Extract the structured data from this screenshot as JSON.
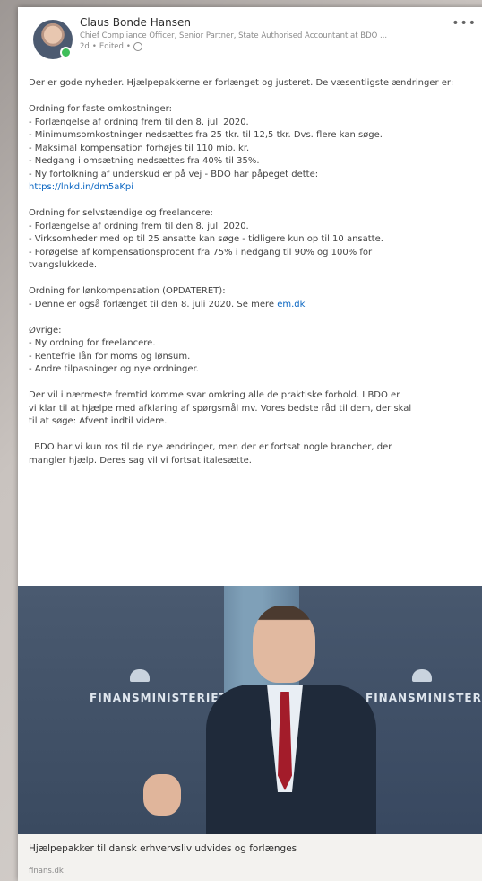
{
  "post": {
    "author_name": "Claus Bonde Hansen",
    "author_title": "Chief Compliance Officer, Senior Partner, State Authorised Accountant at BDO ...",
    "time": "2d",
    "edited": "Edited",
    "more_icon": "more-options-icon",
    "intro": "Der er gode nyheder. Hjælpepakkerne er forlænget og justeret. De væsentligste ændringer er:",
    "sections": {
      "faste": {
        "heading": "Ordning for faste omkostninger:",
        "lines": [
          "- Forlængelse af ordning frem til den 8. juli 2020.",
          "- Minimumsomkostninger nedsættes fra 25 tkr. til 12,5 tkr. Dvs. flere kan søge.",
          "- Maksimal kompensation forhøjes til 110 mio. kr.",
          "- Nedgang i omsætning nedsættes fra 40% til 35%.",
          "- Ny fortolkning af underskud er på vej - BDO har påpeget dette:"
        ],
        "link": "https://lnkd.in/dm5aKpi"
      },
      "selvstaendige": {
        "heading": "Ordning for selvstændige og freelancere:",
        "lines": [
          "- Forlængelse af ordning frem til den 8. juli 2020.",
          "- Virksomheder med op til 25 ansatte kan søge - tidligere kun op til 10 ansatte.",
          "- Forøgelse af kompensationsprocent fra 75% i nedgang til 90% og 100% for",
          "tvangslukkede."
        ]
      },
      "loen": {
        "heading": "Ordning for lønkompensation (OPDATERET):",
        "line_text": "- Denne er også forlænget til den 8. juli 2020.  Se mere ",
        "line_link": "em.dk"
      },
      "oevrige": {
        "heading": "Øvrige:",
        "lines": [
          "- Ny ordning for freelancere.",
          "- Rentefrie lån for moms og lønsum.",
          "- Andre tilpasninger og nye ordninger."
        ]
      }
    },
    "closing_1": [
      "Der vil i nærmeste fremtid komme svar omkring alle de praktiske forhold. I BDO er",
      "vi klar til at hjælpe med afklaring af spørgsmål mv. Vores bedste råd til dem, der skal",
      "til at søge: Afvent indtil videre."
    ],
    "closing_2": [
      "I BDO har vi kun ros til de nye ændringer, men der er fortsat nogle brancher, der",
      "mangler hjælp. Deres sag vil vi fortsat italesætte."
    ],
    "image_text_left": "FINANSMINISTERIET",
    "image_text_right": "FINANSMINISTERIET",
    "caption_title": "Hjælpepakker til dansk erhvervsliv udvides og forlænges",
    "caption_source": "finans.dk"
  }
}
